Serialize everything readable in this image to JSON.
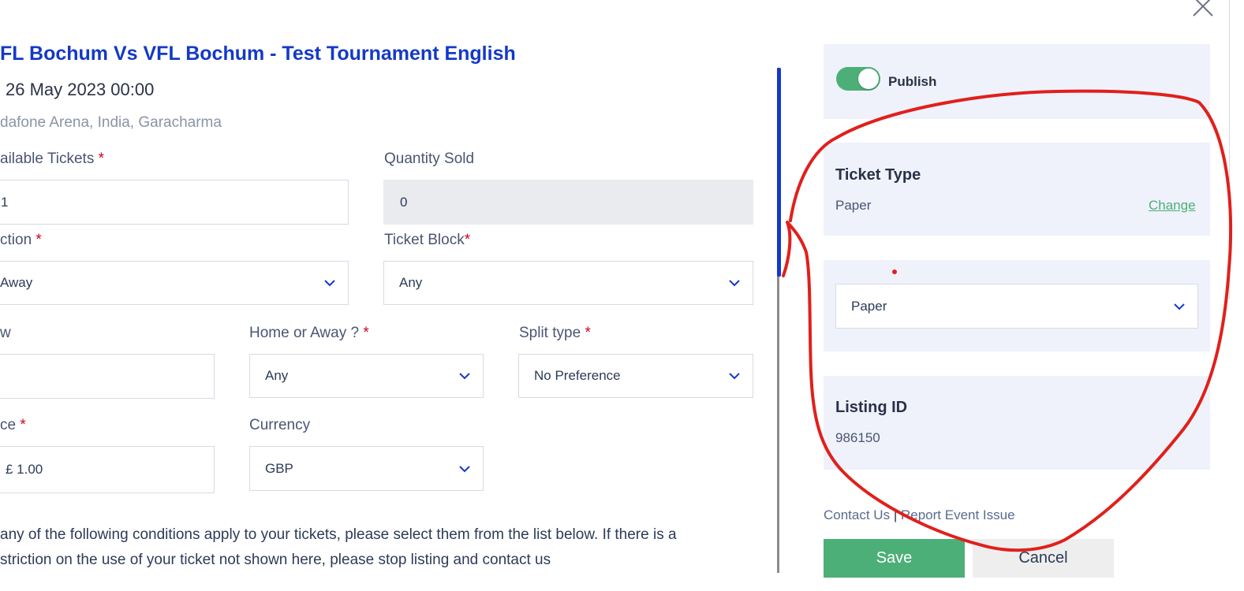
{
  "event": {
    "title": "FL Bochum Vs VFL Bochum - Test Tournament English",
    "date": "26 May 2023 00:00",
    "venue": "dafone Arena, India, Garacharma"
  },
  "form": {
    "available_tickets": {
      "label": "ailable Tickets",
      "required": "*",
      "value": "1"
    },
    "quantity_sold": {
      "label": "Quantity Sold",
      "value": "0"
    },
    "section": {
      "label": "ction",
      "required": "*",
      "value": "Away"
    },
    "ticket_block": {
      "label": "Ticket Block",
      "required": "*",
      "value": "Any"
    },
    "row": {
      "label": "w",
      "value": ""
    },
    "home_or_away": {
      "label": "Home or Away ?",
      "required": "*",
      "value": "Any"
    },
    "split_type": {
      "label": "Split type",
      "required": "*",
      "value": "No Preference"
    },
    "price": {
      "label": "ce",
      "required": "*",
      "value": "£ 1.00"
    },
    "currency": {
      "label": "Currency",
      "value": "GBP"
    },
    "conditions_text_line1": "any of the following conditions apply to your tickets, please select them from the list below. If there is a",
    "conditions_text_line2": "striction on the use of your ticket not shown here, please stop listing and contact us"
  },
  "sidebar": {
    "publish_label": "Publish",
    "publish_on": true,
    "ticket_type": {
      "heading": "Ticket Type",
      "value": "Paper",
      "change_label": "Change"
    },
    "ticket_format_select": {
      "value": "Paper"
    },
    "listing": {
      "heading": "Listing ID",
      "value": "986150"
    },
    "contact_us": "Contact Us",
    "separator": "|",
    "report_issue": "Report Event Issue",
    "save_label": "Save",
    "cancel_label": "Cancel"
  },
  "colors": {
    "accent_blue": "#1439c7",
    "success_green": "#4caf78",
    "annotation_red": "#e0201c",
    "panel_bg": "#eff2fb"
  }
}
